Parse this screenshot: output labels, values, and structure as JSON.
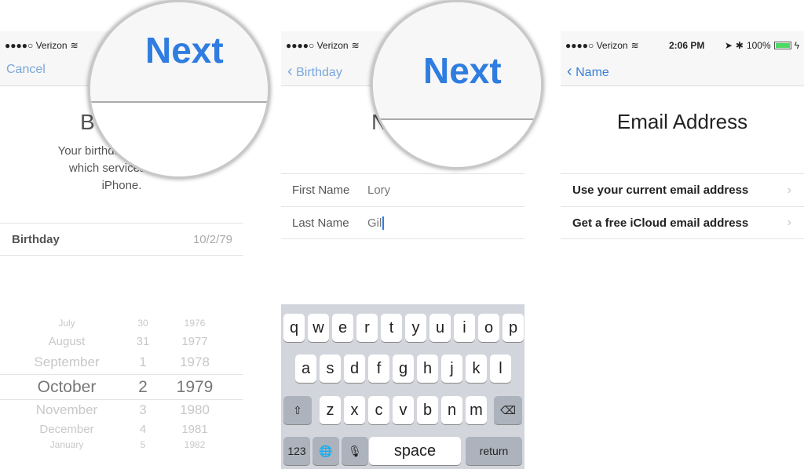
{
  "panel1": {
    "carrier": "●●●●○ Verizon",
    "cancel": "Cancel",
    "next": "Next",
    "title_partial": "B",
    "desc": [
      "Your birthday is",
      "which services to",
      "iPhone."
    ],
    "birthday_label": "Birthday",
    "birthday_value": "10/2/79",
    "picker": {
      "months": [
        "July",
        "August",
        "September",
        "October",
        "November",
        "December",
        "January"
      ],
      "days": [
        "30",
        "31",
        "1",
        "2",
        "3",
        "4",
        "5"
      ],
      "years": [
        "1976",
        "1977",
        "1978",
        "1979",
        "1980",
        "1981",
        "1982"
      ],
      "selected_index": 3
    }
  },
  "panel2": {
    "carrier": "●●●●○ Verizon",
    "back": "Birthday",
    "next": "Next",
    "title_partial": "N",
    "first_name_label": "First Name",
    "first_name_value": "Lory",
    "last_name_label": "Last Name",
    "last_name_value": "Gil",
    "keyboard": {
      "row1": [
        "q",
        "w",
        "e",
        "r",
        "t",
        "y",
        "u",
        "i",
        "o",
        "p"
      ],
      "row2": [
        "a",
        "s",
        "d",
        "f",
        "g",
        "h",
        "j",
        "k",
        "l"
      ],
      "row3": [
        "z",
        "x",
        "c",
        "v",
        "b",
        "n",
        "m"
      ],
      "shift": "⇧",
      "delete": "⌫",
      "numbers": "123",
      "globe": "🌐",
      "mic": "🎙",
      "space": "space",
      "return": "return"
    }
  },
  "panel3": {
    "carrier": "●●●●○ Verizon",
    "time": "2:06 PM",
    "battery": "100%",
    "back": "Name",
    "title": "Email Address",
    "options": [
      "Use your current email address",
      "Get a free iCloud email address"
    ]
  },
  "colors": {
    "accent": "#2f7de0",
    "battery": "#4cd964"
  }
}
